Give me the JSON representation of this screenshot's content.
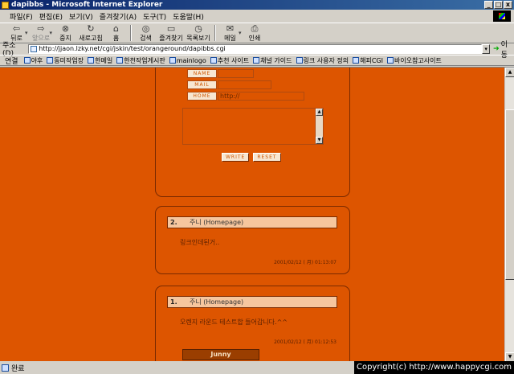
{
  "window": {
    "title": "dapibbs - Microsoft Internet Explorer",
    "min": "_",
    "max": "□",
    "close": "x"
  },
  "menu": [
    "파일(F)",
    "편집(E)",
    "보기(V)",
    "즐겨찾기(A)",
    "도구(T)",
    "도움말(H)"
  ],
  "toolbar": {
    "back": "뒤로",
    "forward": "앞으로",
    "stop": "중지",
    "refresh": "새로고침",
    "home": "홈",
    "search": "검색",
    "favorites": "즐겨찾기",
    "history": "목록보기",
    "mail": "메일",
    "print": "인쇄"
  },
  "address": {
    "label": "주소(D)",
    "url": "http://jjaon.lzky.net/cgi/jskin/test/orangeround/dapibbs.cgi",
    "go": "이동"
  },
  "links": {
    "label": "연결",
    "items": [
      "야후",
      "동미작업장",
      "한메일",
      "한천작업게시판",
      "mainlogo",
      "추천 사이트",
      "채널 가이드",
      "링크 사용자 정의",
      "해피CGI",
      "바이오참고사이트"
    ]
  },
  "form": {
    "name_label": "NAME",
    "mail_label": "MAIL",
    "home_label": "HOME",
    "home_value": "http://",
    "write_label": "WRITE",
    "reset_label": "RESET"
  },
  "posts": [
    {
      "num": "2.",
      "author": "주니 (Homepage)",
      "body": "링크인데된거..",
      "date": "2001/02/12 ( 月) 01:13:07"
    },
    {
      "num": "1.",
      "author": "주니 (Homepage)",
      "body": "오렌지 라운드 테스트합 들어갑니다.^^",
      "date": "2001/02/12 ( 月) 01:12:53",
      "badge": "Junny"
    }
  ],
  "status": {
    "text": "완료",
    "copyright": "Copyright(c) http://www.happycgi.com"
  },
  "colors": {
    "page_bg": "#dd5500",
    "header_bg": "#f6c69e",
    "badge_bg": "#9a3e00"
  }
}
